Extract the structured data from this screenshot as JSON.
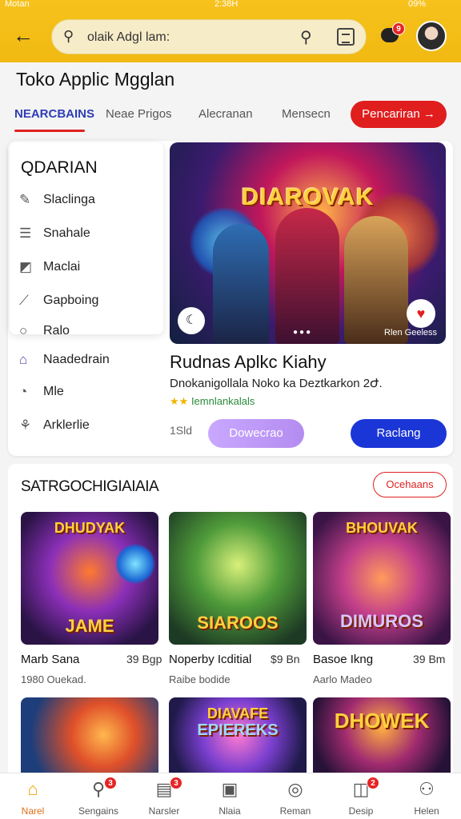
{
  "status": {
    "left": "Motan",
    "center": "2:38H",
    "right": "09%"
  },
  "search": {
    "value": "olaik Adgl lam:"
  },
  "header": {
    "chat_badge": "9"
  },
  "page_title": "Toko Applic Mgglan",
  "tabs": [
    {
      "label": "NEARCBAINS"
    },
    {
      "label": "Neae Prigos"
    },
    {
      "label": "Alecranan"
    },
    {
      "label": "Mensecn"
    }
  ],
  "tab_cta": "Pencariran →",
  "menu": {
    "title": "QDARIAN",
    "items": [
      {
        "label": "Slaclinga",
        "icon": "✎"
      },
      {
        "label": "Snahale",
        "icon": "☰"
      },
      {
        "label": "Maclai",
        "icon": "◩"
      },
      {
        "label": "Gapboing",
        "icon": "⟋"
      },
      {
        "label": "Ralo",
        "icon": "○"
      },
      {
        "label": "Naadedrain",
        "icon": "⌂"
      },
      {
        "label": "Mle",
        "icon": "◔"
      },
      {
        "label": "Arklerlie",
        "icon": "⚘"
      }
    ]
  },
  "banner": {
    "title": "DIAROVAK",
    "tag": "Rlen Geeless"
  },
  "featured": {
    "title": "Rudnas Aplkc Kiahy",
    "subtitle": "Dnokanigollala Noko ka Deztkarkon 2Ժ.",
    "meta": "Iemnlankalals",
    "count": "1Sld",
    "btn_secondary": "Dowecrao",
    "btn_primary": "Raclang"
  },
  "section": {
    "title": "SATRGOCHIGIAIAIA",
    "action": "Ocehaans",
    "games": [
      {
        "title": "DHUDYAK",
        "art": "JAME",
        "name": "Marb Sana",
        "price": "39 Bgp",
        "sub": "1980 Ouekad."
      },
      {
        "title": "",
        "art": "SIAROOS",
        "name": "Noperby Icditial",
        "price": "$9 Bn",
        "sub": "Raibe bodide"
      },
      {
        "title": "BHOUVAK",
        "art": "DIMUROS",
        "name": "Basoe Ikng",
        "price": "39 Bm",
        "sub": "Aarlo Madeo"
      },
      {
        "title": "",
        "art": "",
        "name": "",
        "price": "",
        "sub": ""
      },
      {
        "title": "DIAVAFE",
        "art": "EPIEREKS",
        "name": "",
        "price": "",
        "sub": ""
      },
      {
        "title": "DHOWEK",
        "art": "",
        "name": "",
        "price": "",
        "sub": ""
      }
    ]
  },
  "bottom_nav": [
    {
      "label": "Narel",
      "icon": "⌂",
      "badge": ""
    },
    {
      "label": "Sengains",
      "icon": "⚲",
      "badge": "3"
    },
    {
      "label": "Narsler",
      "icon": "▤",
      "badge": "3"
    },
    {
      "label": "Nlaia",
      "icon": "▣",
      "badge": ""
    },
    {
      "label": "Reman",
      "icon": "◎",
      "badge": ""
    },
    {
      "label": "Desip",
      "icon": "◫",
      "badge": "2"
    },
    {
      "label": "Helen",
      "icon": "⚇",
      "badge": ""
    }
  ],
  "colors": {
    "accent": "#f1b912",
    "primary": "#1b36d6",
    "danger": "#e01e1e",
    "tab_active": "#2f3db6"
  }
}
